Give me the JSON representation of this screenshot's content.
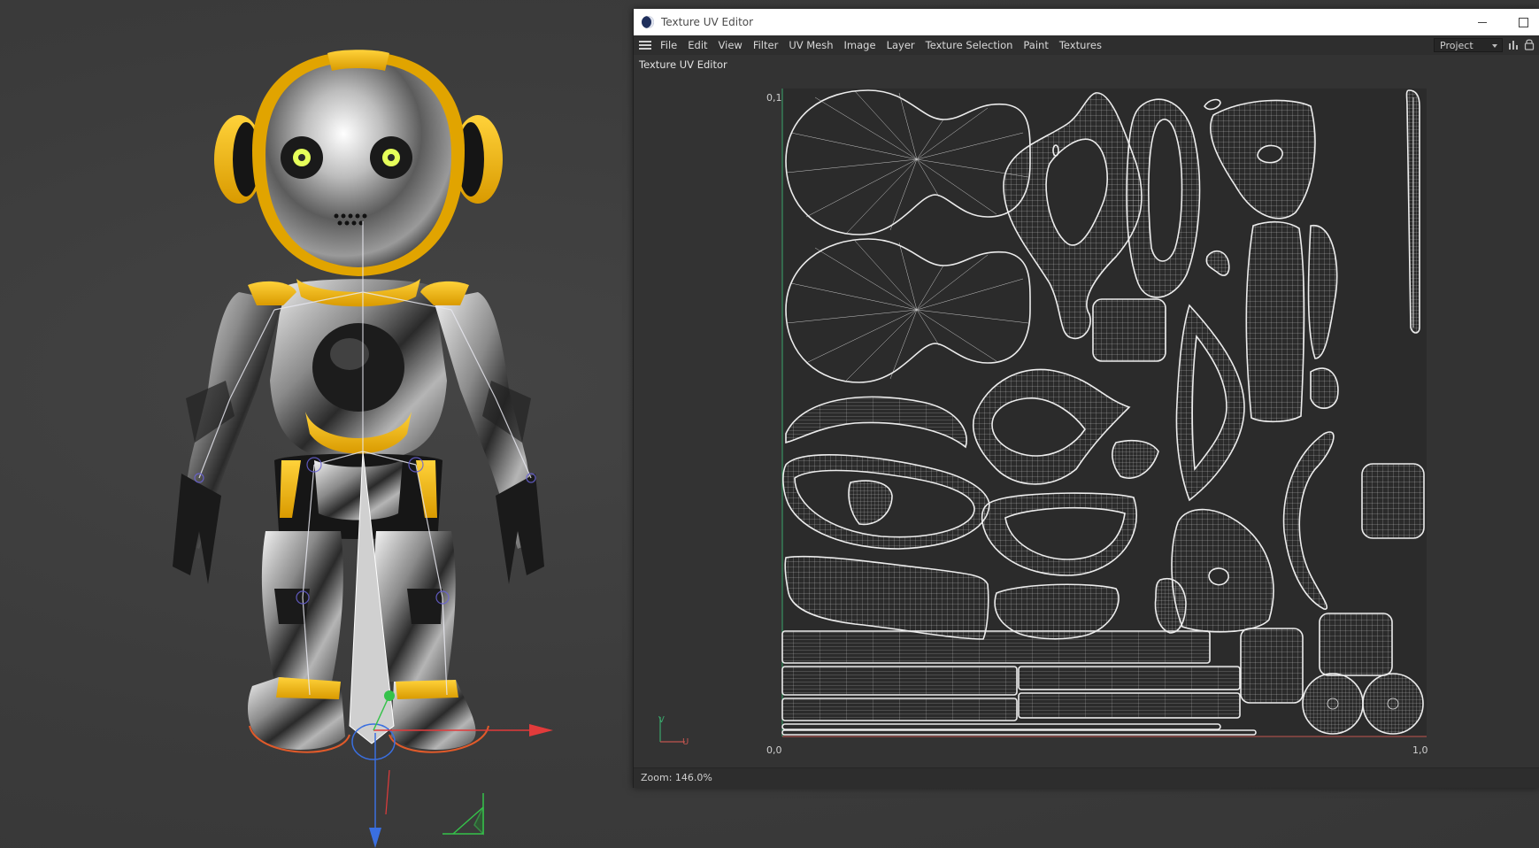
{
  "viewport": {
    "model": "robot character",
    "gizmo_colors": {
      "x": "#e23b3b",
      "y": "#35c24a",
      "z": "#3a6fe0"
    }
  },
  "uv_editor": {
    "window_title": "Texture UV Editor",
    "window_controls": {
      "minimize_icon": "minimize-icon",
      "maximize_icon": "maximize-icon"
    },
    "menu": [
      {
        "label": "File"
      },
      {
        "label": "Edit"
      },
      {
        "label": "View"
      },
      {
        "label": "Filter"
      },
      {
        "label": "UV Mesh"
      },
      {
        "label": "Image"
      },
      {
        "label": "Layer"
      },
      {
        "label": "Texture Selection"
      },
      {
        "label": "Paint"
      },
      {
        "label": "Textures"
      }
    ],
    "layout_select": "Project",
    "panel_title": "Texture UV Editor",
    "axis_labels": {
      "top_left": "0,1",
      "bottom_left": "0,0",
      "bottom_right": "1,0"
    },
    "axis_gizmo": {
      "v": "V",
      "u": "U"
    },
    "status": {
      "zoom": "Zoom: 146.0%"
    },
    "colors": {
      "wire": "#e6e6e6",
      "canvas": "#2b2b2b",
      "v_axis": "#3aa56b",
      "u_axis": "#c0554f"
    }
  }
}
